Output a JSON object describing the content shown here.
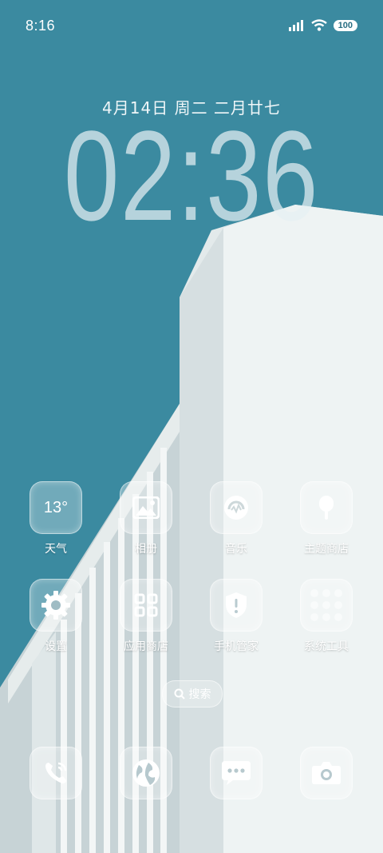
{
  "status_bar": {
    "time": "8:16",
    "battery": "100"
  },
  "lockscreen": {
    "date": "4月14日 周二 二月廿七",
    "clock": "02:36"
  },
  "apps": [
    {
      "label": "天气",
      "icon": "weather-icon",
      "temp": "13°"
    },
    {
      "label": "相册",
      "icon": "gallery-icon"
    },
    {
      "label": "音乐",
      "icon": "music-icon"
    },
    {
      "label": "主题商店",
      "icon": "theme-store-icon"
    },
    {
      "label": "设置",
      "icon": "settings-gear-icon"
    },
    {
      "label": "应用商店",
      "icon": "app-store-icon"
    },
    {
      "label": "手机管家",
      "icon": "security-shield-icon"
    },
    {
      "label": "系统工具",
      "icon": "tools-folder-icon"
    }
  ],
  "search": {
    "label": "搜索"
  },
  "dock": [
    {
      "icon": "phone-icon"
    },
    {
      "icon": "browser-icon"
    },
    {
      "icon": "messages-icon"
    },
    {
      "icon": "camera-icon"
    }
  ],
  "colors": {
    "sky": "#3b8aa0",
    "wall": "#e9efef",
    "glass": "rgba(255,255,255,0.28)"
  }
}
